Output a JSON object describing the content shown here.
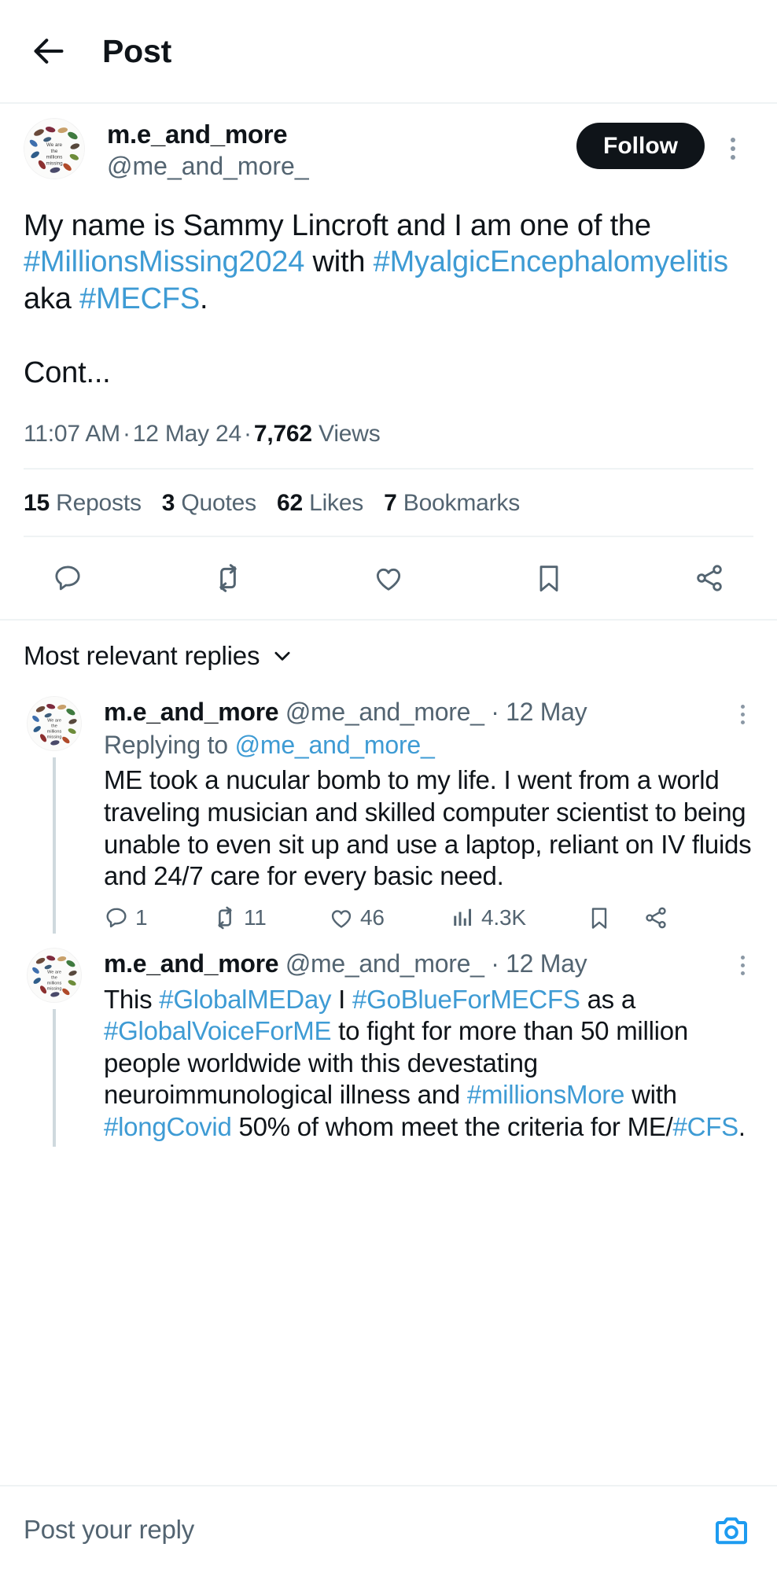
{
  "header": {
    "back_icon": "arrow-left-icon",
    "title": "Post"
  },
  "post": {
    "author": {
      "display_name": "m.e_and_more",
      "handle": "@me_and_more_",
      "avatar_alt": "We are the millions missing"
    },
    "follow_label": "Follow",
    "more_icon": "more-vertical-icon",
    "text_segments": [
      {
        "text": "My name is Sammy Lincroft and I am one of the ",
        "type": "plain"
      },
      {
        "text": "#MillionsMissing2024",
        "type": "link"
      },
      {
        "text": " with ",
        "type": "plain"
      },
      {
        "text": "#MyalgicEncephalomyelitis",
        "type": "link"
      },
      {
        "text": " aka ",
        "type": "plain"
      },
      {
        "text": "#MECFS",
        "type": "link"
      },
      {
        "text": ".",
        "type": "plain"
      }
    ],
    "text_paragraph_2": "Cont...",
    "timestamp": "11:07 AM",
    "date": "12 May 24",
    "views_count": "7,762",
    "views_label": "Views",
    "separator": "·",
    "stats": [
      {
        "num": "15",
        "label": "Reposts"
      },
      {
        "num": "3",
        "label": "Quotes"
      },
      {
        "num": "62",
        "label": "Likes"
      },
      {
        "num": "7",
        "label": "Bookmarks"
      }
    ],
    "actions": [
      {
        "name": "reply-icon"
      },
      {
        "name": "repost-icon"
      },
      {
        "name": "like-icon"
      },
      {
        "name": "bookmark-icon"
      },
      {
        "name": "share-icon"
      }
    ]
  },
  "replies_section": {
    "sort_label": "Most relevant replies",
    "chevron_icon": "chevron-down-icon"
  },
  "replies": [
    {
      "display_name": "m.e_and_more",
      "handle": "@me_and_more_",
      "separator": "·",
      "date": "12 May",
      "replying_to_prefix": "Replying to ",
      "replying_to_handle": "@me_and_more_",
      "text": "ME took a nucular bomb to my life. I went from a world traveling musician and skilled computer scientist to being unable to even sit up and use a laptop, reliant on IV fluids and 24/7 care for every basic need.",
      "reply_count": "1",
      "repost_count": "11",
      "like_count": "46",
      "view_count": "4.3K"
    },
    {
      "display_name": "m.e_and_more",
      "handle": "@me_and_more_",
      "separator": "·",
      "date": "12 May",
      "text_segments": [
        {
          "text": "This ",
          "type": "plain"
        },
        {
          "text": "#GlobalMEDay",
          "type": "link"
        },
        {
          "text": " I ",
          "type": "plain"
        },
        {
          "text": "#GoBlueForMECFS",
          "type": "link"
        },
        {
          "text": " as a ",
          "type": "plain"
        },
        {
          "text": "#GlobalVoiceForME",
          "type": "link"
        },
        {
          "text": " to fight for more than 50 million people worldwide with this devestating neuroimmunological illness and ",
          "type": "plain"
        },
        {
          "text": "#millionsMore",
          "type": "link"
        },
        {
          "text": " with ",
          "type": "plain"
        },
        {
          "text": "#longCovid",
          "type": "link"
        },
        {
          "text": " 50% of whom meet the criteria for ME/",
          "type": "plain"
        },
        {
          "text": "#CFS",
          "type": "link"
        },
        {
          "text": ".",
          "type": "plain"
        }
      ]
    }
  ],
  "composer": {
    "placeholder": "Post your reply",
    "camera_icon": "camera-icon"
  },
  "colors": {
    "link_blue": "#3e9bd4",
    "accent_blue": "#1d9bf0",
    "text_primary": "#0f1419",
    "text_secondary": "#536471",
    "border": "#eff3f4",
    "follow_bg": "#0f1419"
  }
}
